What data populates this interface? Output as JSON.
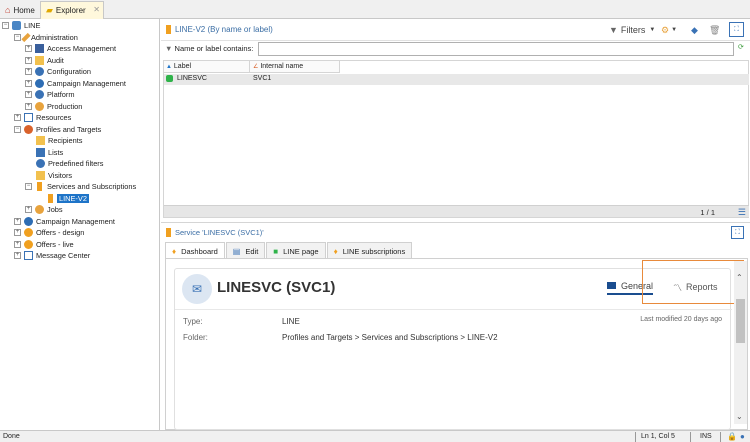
{
  "topbar": {
    "home_label": "Home",
    "explorer_label": "Explorer"
  },
  "tree": {
    "root": "LINE",
    "administration": "Administration",
    "access_management": "Access Management",
    "audit": "Audit",
    "configuration": "Configuration",
    "campaign_management_admin": "Campaign Management",
    "platform": "Platform",
    "production": "Production",
    "resources": "Resources",
    "profiles_and_targets": "Profiles and Targets",
    "recipients": "Recipients",
    "lists": "Lists",
    "predefined_filters": "Predefined filters",
    "visitors": "Visitors",
    "services_and_subscriptions": "Services and Subscriptions",
    "line_v2": "LINE-V2",
    "jobs": "Jobs",
    "campaign_management": "Campaign Management",
    "offers_design": "Offers - design",
    "offers_live": "Offers - live",
    "message_center": "Message Center"
  },
  "list_panel": {
    "title": "LINE-V2 (By name or label)",
    "filters_label": "Filters",
    "filter_label": "Name or label contains:",
    "filter_value": ""
  },
  "grid": {
    "columns": [
      "Label",
      "Internal name"
    ],
    "rows": [
      {
        "label": "LINESVC",
        "internal_name": "SVC1"
      }
    ],
    "count": "1 / 1"
  },
  "detail": {
    "title": "Service 'LINESVC (SVC1)'",
    "tabs": [
      "Dashboard",
      "Edit",
      "LINE page",
      "LINE subscriptions"
    ],
    "record_title": "LINESVC (SVC1)",
    "nav_general": "General",
    "nav_reports": "Reports",
    "type_label": "Type:",
    "type_value": "LINE",
    "folder_label": "Folder:",
    "folder_value": "Profiles and Targets > Services and Subscriptions > LINE-V2",
    "last_modified": "Last modified 20 days ago"
  },
  "status": {
    "left": "Done",
    "position": "Ln 1, Col 5",
    "mode": "INS"
  },
  "colors": {
    "selection": "#1e74c8",
    "accent_title": "#3b6ea5",
    "highlight_box": "#e88a3b"
  }
}
